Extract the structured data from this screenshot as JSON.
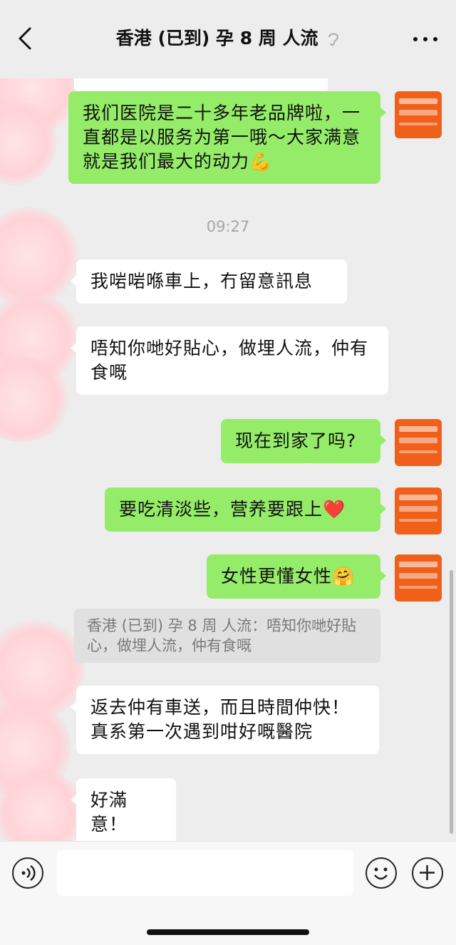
{
  "header": {
    "title": "香港 (已到) 孕 8 周 人流",
    "back_icon": "chevron-left-icon",
    "muted_icon": "ear-icon",
    "more_icon": "more-icon"
  },
  "messages": {
    "m1": "我们医院是二十多年老品牌啦，一直都是以服务为第一哦～大家满意就是我们最大的动力💪",
    "time": "09:27",
    "m2": "我啱啱喺車上，冇留意訊息",
    "m3": "唔知你哋好貼心，做埋人流，仲有食嘅",
    "m4": "现在到家了吗?",
    "m5": "要吃清淡些，营养要跟上❤️",
    "m6": "女性更懂女性🤗",
    "quote": "香港 (已到) 孕 8 周 人流：唔知你哋好貼心，做埋人流，仲有食嘅",
    "m7": "返去仲有車送，而且時間仲快！真系第一次遇到咁好嘅醫院",
    "m8": "好滿意！"
  },
  "input": {
    "value": "",
    "voice_icon": "voice-icon",
    "emoji_icon": "emoji-icon",
    "add_icon": "plus-icon"
  },
  "colors": {
    "background": "#ededed",
    "my_bubble": "#95ec69",
    "their_bubble": "#ffffff",
    "avatar": "#f0601a"
  }
}
